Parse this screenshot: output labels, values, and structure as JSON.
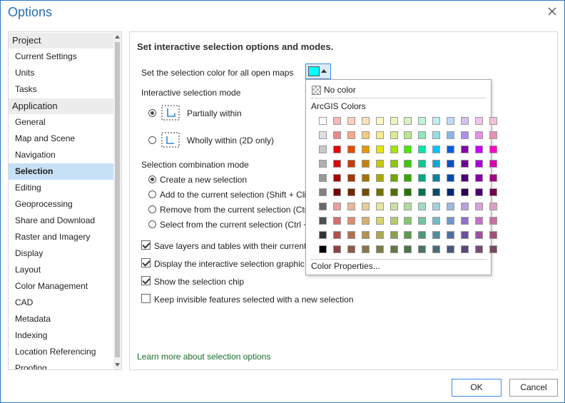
{
  "window": {
    "title": "Options"
  },
  "sidebar": {
    "groups": [
      {
        "label": "Project",
        "items": [
          "Current Settings",
          "Units",
          "Tasks"
        ]
      },
      {
        "label": "Application",
        "items": [
          "General",
          "Map and Scene",
          "Navigation",
          "Selection",
          "Editing",
          "Geoprocessing",
          "Share and Download",
          "Raster and Imagery",
          "Display",
          "Layout",
          "Color Management",
          "CAD",
          "Metadata",
          "Indexing",
          "Location Referencing",
          "Proofing"
        ]
      }
    ],
    "selected": "Selection"
  },
  "content": {
    "heading": "Set interactive selection options and modes.",
    "color_label": "Set the selection color for all open maps",
    "selection_color": "#00ffff",
    "mode_label": "Interactive selection mode",
    "modes": [
      {
        "label": "Partially within",
        "checked": true
      },
      {
        "label": "Wholly within (2D only)",
        "checked": false
      }
    ],
    "combination_label": "Selection combination mode",
    "combinations": [
      {
        "label": "Create a new selection",
        "checked": true
      },
      {
        "label": "Add to the current selection (Shift + Cli",
        "checked": false
      },
      {
        "label": "Remove from the current selection (Ctrl",
        "checked": false
      },
      {
        "label": "Select from the current selection (Ctrl +",
        "checked": false
      }
    ],
    "checkboxes": [
      {
        "label": "Save layers and tables with their current s",
        "checked": true
      },
      {
        "label": "Display the interactive selection graphic",
        "checked": true
      },
      {
        "label": "Show the selection chip",
        "checked": true
      },
      {
        "label": "Keep invisible features selected with a new selection",
        "checked": false
      }
    ],
    "learn_more": "Learn more about selection options"
  },
  "color_dropdown": {
    "no_color": "No color",
    "palette_name": "ArcGIS Colors",
    "properties": "Color Properties...",
    "rows": [
      [
        "#ffffff",
        "#f4b8b8",
        "#fdcfbd",
        "#fde2b8",
        "#fdf6c0",
        "#ecf7c0",
        "#d6f2c0",
        "#c0f2d6",
        "#c0eef2",
        "#c0d9f2",
        "#d2c0f2",
        "#f2c0f2",
        "#f2c0d9"
      ],
      [
        "#e0e0e0",
        "#e88a8a",
        "#f4a88b",
        "#f7c97e",
        "#f6ec8f",
        "#d9ef8f",
        "#b7e88f",
        "#8fe8b7",
        "#8fe0e8",
        "#8fb5e8",
        "#a98fe8",
        "#e88fe8",
        "#e88fb5"
      ],
      [
        "#c8c8c8",
        "#e60000",
        "#e64c00",
        "#e69800",
        "#e6e600",
        "#a3e600",
        "#4ce600",
        "#00e6a9",
        "#00c5ff",
        "#005ce6",
        "#8400a8",
        "#c500ff",
        "#ff00c5"
      ],
      [
        "#b0b0b0",
        "#d40000",
        "#c83c00",
        "#c88000",
        "#c8c800",
        "#8cc800",
        "#3cc800",
        "#00c890",
        "#00a8d8",
        "#0050c8",
        "#6c0090",
        "#a800d8",
        "#d800a8"
      ],
      [
        "#989898",
        "#a80000",
        "#a83800",
        "#a87000",
        "#a8a800",
        "#70a800",
        "#38a800",
        "#00a884",
        "#0084a8",
        "#004da8",
        "#4c0073",
        "#8400a8",
        "#a80084"
      ],
      [
        "#808080",
        "#730000",
        "#732600",
        "#734c00",
        "#737300",
        "#4c7300",
        "#267300",
        "#00734c",
        "#004c73",
        "#002673",
        "#2c0050",
        "#4c0073",
        "#73004c"
      ],
      [
        "#686868",
        "#e6a0a0",
        "#e8b89a",
        "#e6cc9a",
        "#e6e6a0",
        "#c8e0a0",
        "#b0dca0",
        "#a0dcc0",
        "#a0d4dc",
        "#a0b8dc",
        "#b8a0dc",
        "#dca0dc",
        "#dca0c0"
      ],
      [
        "#505050",
        "#d07070",
        "#d89070",
        "#d4b070",
        "#d4d470",
        "#b0cc70",
        "#88c470",
        "#70c4a0",
        "#70bcc8",
        "#7098c8",
        "#9070c8",
        "#c870c8",
        "#c870a0"
      ],
      [
        "#343434",
        "#b05050",
        "#b47050",
        "#b09450",
        "#a8a850",
        "#88a050",
        "#609850",
        "#509878",
        "#508ca0",
        "#5070a0",
        "#6c50a0",
        "#a050a0",
        "#a05078"
      ],
      [
        "#000000",
        "#884444",
        "#8c5c44",
        "#88744a",
        "#7c7c48",
        "#647848",
        "#4c7448",
        "#487460",
        "#486c78",
        "#485878",
        "#584878",
        "#784878",
        "#784860"
      ]
    ]
  },
  "buttons": {
    "ok": "OK",
    "cancel": "Cancel"
  }
}
